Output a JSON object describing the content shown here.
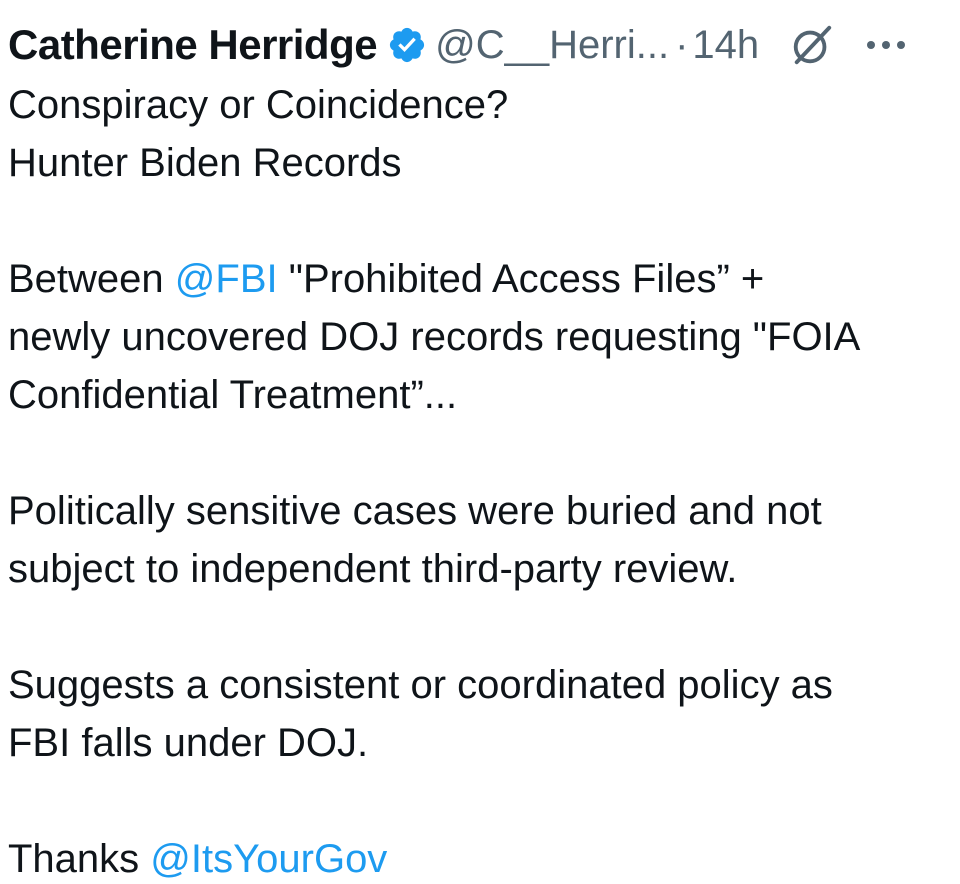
{
  "tweet": {
    "display_name": "Catherine Herridge",
    "handle": "@C__Herri...",
    "separator": "·",
    "time": "14h",
    "icons": {
      "verified": "verified-badge-icon",
      "grok": "grok-icon",
      "more": "more-options-icon"
    },
    "colors": {
      "text": "#0f1419",
      "secondary": "#536471",
      "accent": "#1d9bf0"
    },
    "lines": [
      "Conspiracy or Coincidence?",
      "Hunter Biden Records",
      "",
      {
        "before": "Between ",
        "mention": "@FBI",
        "after": " \"Prohibited Access Files” +"
      },
      "newly uncovered DOJ records requesting \"FOIA",
      "Confidential Treatment”...",
      "",
      "Politically sensitive cases were buried and not",
      "subject to independent third-party review.",
      "",
      "Suggests a consistent or coordinated policy as",
      "FBI falls under DOJ.",
      "",
      {
        "before": "Thanks ",
        "mention": "@ItsYourGov",
        "after": ""
      }
    ]
  }
}
